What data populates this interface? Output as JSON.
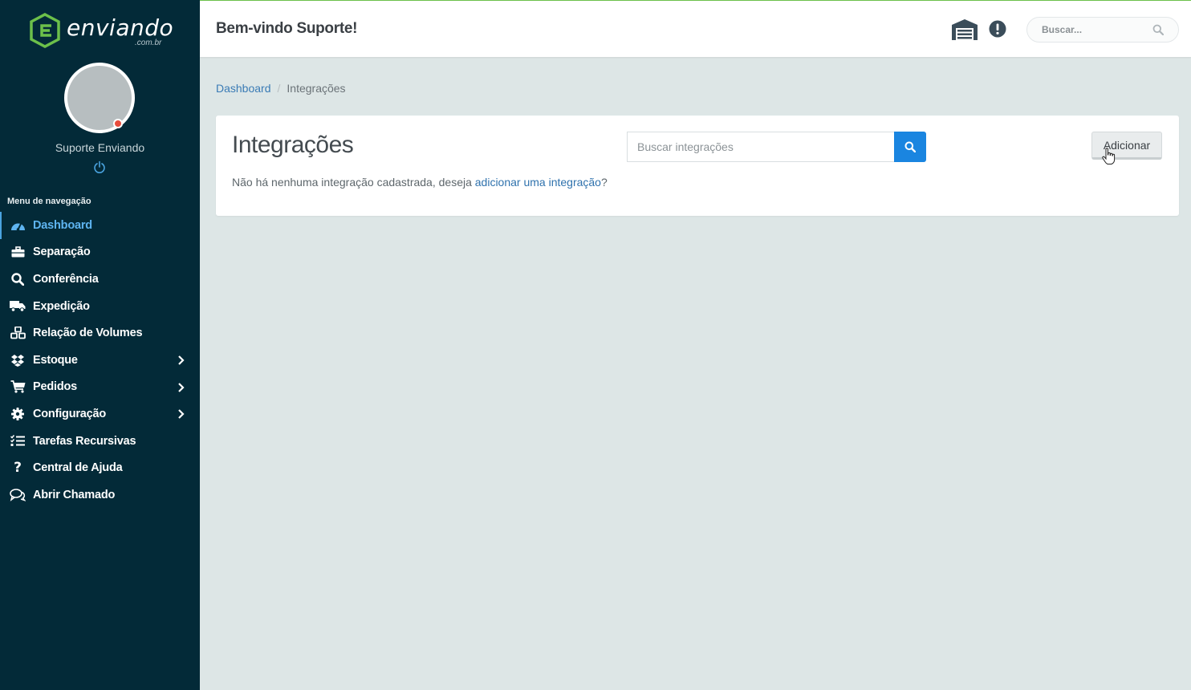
{
  "brand": {
    "name": "enviando",
    "suffix": ".com.br",
    "accent": "#6cc04a"
  },
  "sidebar": {
    "user_name": "Suporte Enviando",
    "nav_heading": "Menu de navegação",
    "items": [
      {
        "label": "Dashboard",
        "icon": "tachometer-icon"
      },
      {
        "label": "Separação",
        "icon": "briefcase-icon"
      },
      {
        "label": "Conferência",
        "icon": "search-icon"
      },
      {
        "label": "Expedição",
        "icon": "truck-icon"
      },
      {
        "label": "Relação de Volumes",
        "icon": "cubes-icon"
      },
      {
        "label": "Estoque",
        "icon": "dropbox-icon"
      },
      {
        "label": "Pedidos",
        "icon": "cart-icon"
      },
      {
        "label": "Configuração",
        "icon": "gear-icon"
      },
      {
        "label": "Tarefas Recursivas",
        "icon": "tasks-icon"
      },
      {
        "label": "Central de Ajuda",
        "icon": "question-icon"
      },
      {
        "label": "Abrir Chamado",
        "icon": "comments-icon"
      }
    ]
  },
  "header": {
    "title": "Bem-vindo Suporte!",
    "search_placeholder": "Buscar..."
  },
  "breadcrumb": {
    "root": "Dashboard",
    "separator": "/",
    "current": "Integrações"
  },
  "card": {
    "title": "Integrações",
    "search_placeholder": "Buscar integrações",
    "add_label": "Adicionar",
    "empty_prefix": "Não há nenhuma integração cadastrada, deseja ",
    "empty_link": "adicionar uma integração",
    "empty_suffix": "?"
  }
}
